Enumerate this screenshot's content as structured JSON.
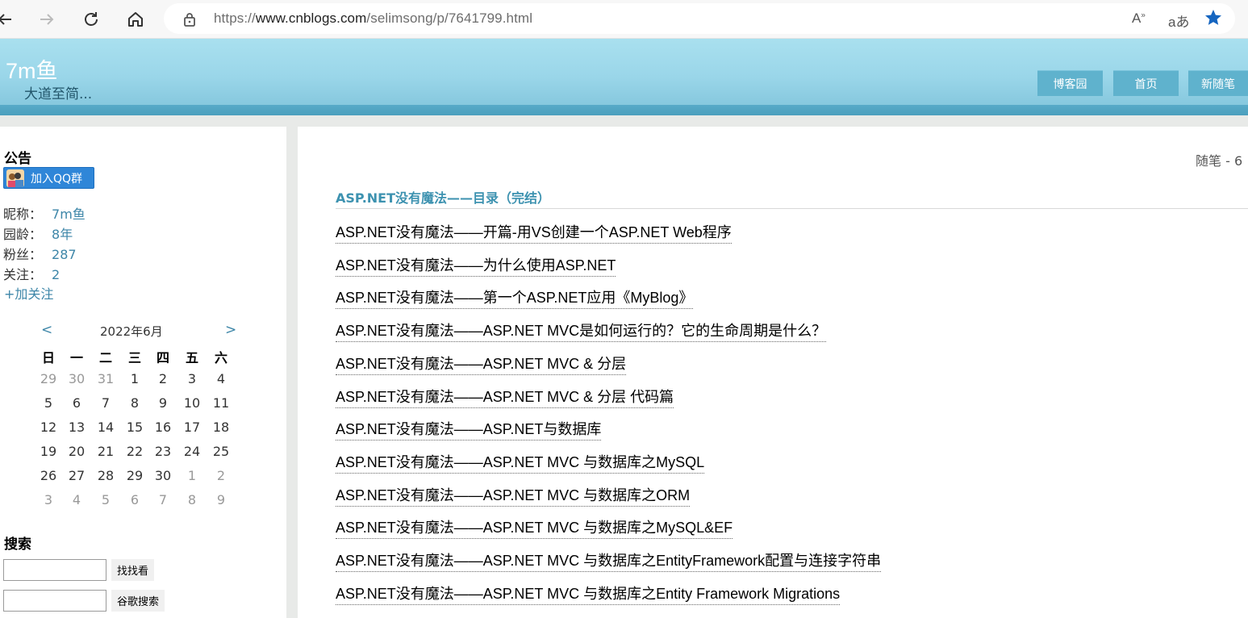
{
  "browser": {
    "back_icon": "back-arrow-icon",
    "forward_icon": "forward-arrow-icon",
    "url_prefix": "https://",
    "url_domain": "www.cnblogs.com",
    "url_path": "/selimsong/p/7641799.html",
    "read_aloud": "A",
    "translate": "aあ"
  },
  "header": {
    "title": "7m鱼",
    "subtitle": "大道至简...",
    "nav": [
      "博客园",
      "首页",
      "新随笔"
    ]
  },
  "sidebar": {
    "notice_heading": "公告",
    "qq_button": "加入QQ群",
    "profile": [
      {
        "label": "昵称：",
        "value": "7m鱼"
      },
      {
        "label": "园龄：",
        "value": "8年"
      },
      {
        "label": "粉丝：",
        "value": "287"
      },
      {
        "label": "关注：",
        "value": "2"
      }
    ],
    "follow_link": "+加关注",
    "calendar": {
      "prev": "<",
      "next": ">",
      "title": "2022年6月",
      "weekdays": [
        "日",
        "一",
        "二",
        "三",
        "四",
        "五",
        "六"
      ],
      "weeks": [
        [
          "29",
          "30",
          "31",
          "1",
          "2",
          "3",
          "4"
        ],
        [
          "5",
          "6",
          "7",
          "8",
          "9",
          "10",
          "11"
        ],
        [
          "12",
          "13",
          "14",
          "15",
          "16",
          "17",
          "18"
        ],
        [
          "19",
          "20",
          "21",
          "22",
          "23",
          "24",
          "25"
        ],
        [
          "26",
          "27",
          "28",
          "29",
          "30",
          "1",
          "2"
        ],
        [
          "3",
          "4",
          "5",
          "6",
          "7",
          "8",
          "9"
        ]
      ]
    },
    "search_heading": "搜索",
    "search_button": "找找看",
    "google_button": "谷歌搜索"
  },
  "main": {
    "stats": "随笔 - 6",
    "category_title": "ASP.NET没有魔法——目录（完结）",
    "posts": [
      "ASP.NET没有魔法——开篇-用VS创建一个ASP.NET Web程序",
      "ASP.NET没有魔法——为什么使用ASP.NET",
      "ASP.NET没有魔法——第一个ASP.NET应用《MyBlog》",
      "ASP.NET没有魔法——ASP.NET MVC是如何运行的？它的生命周期是什么？",
      "ASP.NET没有魔法——ASP.NET MVC & 分层",
      "ASP.NET没有魔法——ASP.NET MVC & 分层 代码篇",
      "ASP.NET没有魔法——ASP.NET与数据库",
      "ASP.NET没有魔法——ASP.NET MVC 与数据库之MySQL",
      "ASP.NET没有魔法——ASP.NET MVC 与数据库之ORM",
      "ASP.NET没有魔法——ASP.NET MVC 与数据库之MySQL&EF",
      "ASP.NET没有魔法——ASP.NET MVC 与数据库之EntityFramework配置与连接字符串",
      "ASP.NET没有魔法——ASP.NET MVC 与数据库之Entity Framework Migrations"
    ]
  }
}
